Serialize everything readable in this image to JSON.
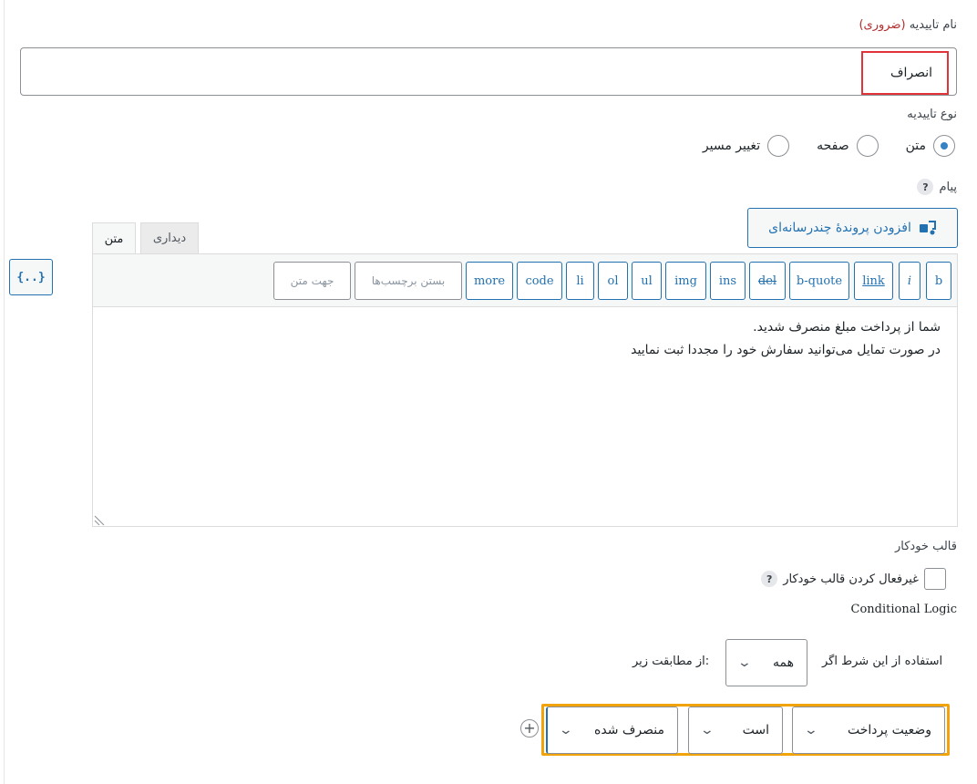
{
  "confirmation_name": {
    "label": "نام تاییدیه",
    "required": "(ضروری)",
    "value": "انصراف"
  },
  "confirmation_type": {
    "label": "نوع تاییدیه",
    "options": [
      {
        "label": "متن",
        "checked": true
      },
      {
        "label": "صفحه",
        "checked": false
      },
      {
        "label": "تغییر مسیر",
        "checked": false
      }
    ]
  },
  "message": {
    "label": "پیام",
    "help": "?",
    "add_media_label": "افزودن پروندهٔ چندرسانه‌ای",
    "merge_tags_label": "{..}",
    "tabs": {
      "text": "متن",
      "visual": "دیداری"
    },
    "toolbar": {
      "b": "b",
      "i": "i",
      "link": "link",
      "b_quote": "b-quote",
      "del": "del",
      "ins": "ins",
      "img": "img",
      "ul": "ul",
      "ol": "ol",
      "li": "li",
      "code": "code",
      "more": "more",
      "close_tags": "بستن برچسب‌ها",
      "text_direction": "جهت متن"
    },
    "content_line1": "شما از پرداخت مبلغ منصرف شدید.",
    "content_line2": "در صورت تمایل می‌توانید سفارش خود را مجددا ثبت نمایید"
  },
  "auto_format": {
    "label": "قالب خودکار",
    "checkbox_label": "غیرفعال کردن قالب خودکار",
    "help": "?",
    "checked": false
  },
  "conditional_logic": {
    "title": "Conditional Logic",
    "prefix": "استفاده از این شرط اگر",
    "match_value": "همه",
    "suffix": "از مطابقت زیر:",
    "rule": {
      "field": "وضعیت پرداخت",
      "operator": "است",
      "value": "منصرف شده"
    },
    "add_rule": "+",
    "highlight_color": "#f0a30a"
  },
  "colors": {
    "accent": "#2271b1",
    "required": "#b32d2e",
    "highlight_red": "#e2323a"
  }
}
